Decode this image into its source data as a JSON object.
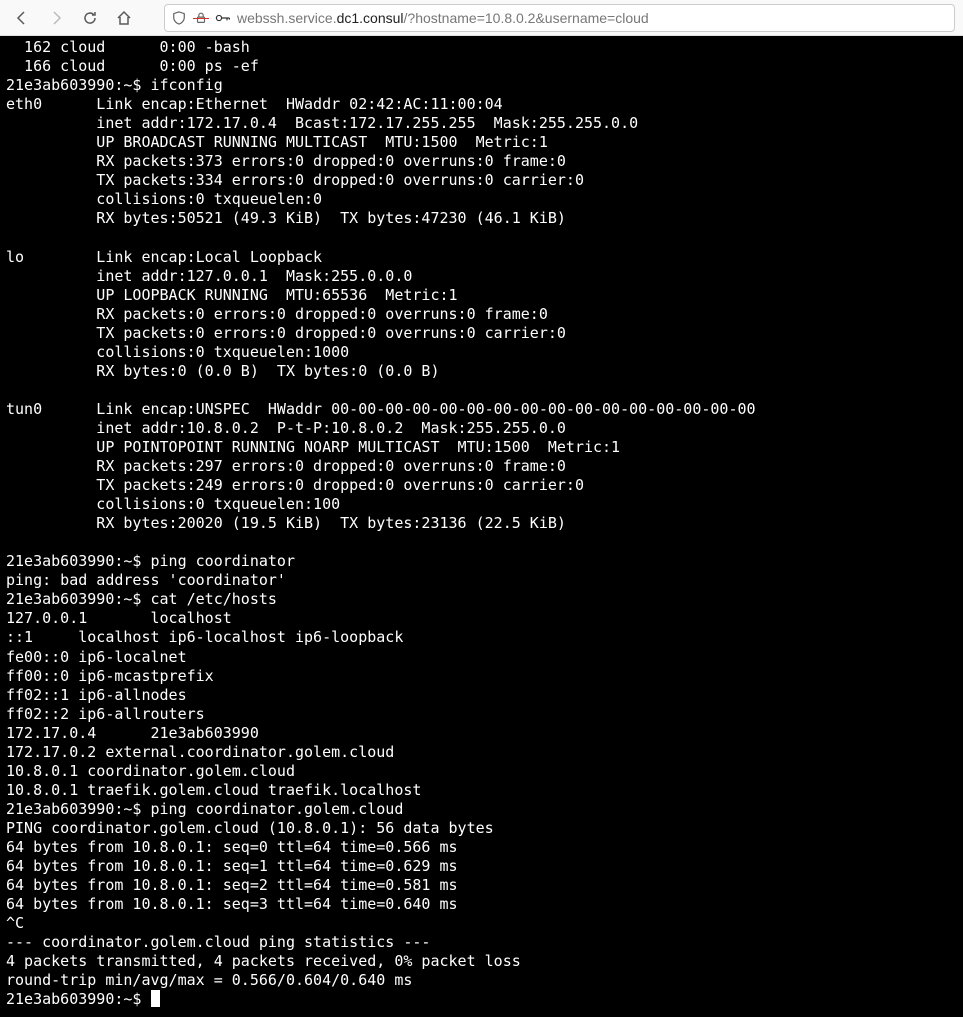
{
  "url": {
    "prefix": "webssh.service.",
    "bold": "dc1.consul",
    "suffix": "/?hostname=10.8.0.2&username=cloud"
  },
  "icons": {
    "back": "back-icon",
    "forward": "forward-icon",
    "reload": "reload-icon",
    "home": "home-icon",
    "shield": "shield-icon",
    "lock": "lock-strike-icon",
    "key": "key-icon"
  },
  "terminal_lines": [
    "  162 cloud      0:00 -bash",
    "  166 cloud      0:00 ps -ef",
    "21e3ab603990:~$ ifconfig",
    "eth0      Link encap:Ethernet  HWaddr 02:42:AC:11:00:04  ",
    "          inet addr:172.17.0.4  Bcast:172.17.255.255  Mask:255.255.0.0",
    "          UP BROADCAST RUNNING MULTICAST  MTU:1500  Metric:1",
    "          RX packets:373 errors:0 dropped:0 overruns:0 frame:0",
    "          TX packets:334 errors:0 dropped:0 overruns:0 carrier:0",
    "          collisions:0 txqueuelen:0 ",
    "          RX bytes:50521 (49.3 KiB)  TX bytes:47230 (46.1 KiB)",
    "",
    "lo        Link encap:Local Loopback  ",
    "          inet addr:127.0.0.1  Mask:255.0.0.0",
    "          UP LOOPBACK RUNNING  MTU:65536  Metric:1",
    "          RX packets:0 errors:0 dropped:0 overruns:0 frame:0",
    "          TX packets:0 errors:0 dropped:0 overruns:0 carrier:0",
    "          collisions:0 txqueuelen:1000 ",
    "          RX bytes:0 (0.0 B)  TX bytes:0 (0.0 B)",
    "",
    "tun0      Link encap:UNSPEC  HWaddr 00-00-00-00-00-00-00-00-00-00-00-00-00-00-00-00  ",
    "          inet addr:10.8.0.2  P-t-P:10.8.0.2  Mask:255.255.0.0",
    "          UP POINTOPOINT RUNNING NOARP MULTICAST  MTU:1500  Metric:1",
    "          RX packets:297 errors:0 dropped:0 overruns:0 frame:0",
    "          TX packets:249 errors:0 dropped:0 overruns:0 carrier:0",
    "          collisions:0 txqueuelen:100 ",
    "          RX bytes:20020 (19.5 KiB)  TX bytes:23136 (22.5 KiB)",
    "",
    "21e3ab603990:~$ ping coordinator",
    "ping: bad address 'coordinator'",
    "21e3ab603990:~$ cat /etc/hosts",
    "127.0.0.1       localhost",
    "::1     localhost ip6-localhost ip6-loopback",
    "fe00::0 ip6-localnet",
    "ff00::0 ip6-mcastprefix",
    "ff02::1 ip6-allnodes",
    "ff02::2 ip6-allrouters",
    "172.17.0.4      21e3ab603990",
    "172.17.0.2 external.coordinator.golem.cloud",
    "10.8.0.1 coordinator.golem.cloud",
    "10.8.0.1 traefik.golem.cloud traefik.localhost",
    "21e3ab603990:~$ ping coordinator.golem.cloud",
    "PING coordinator.golem.cloud (10.8.0.1): 56 data bytes",
    "64 bytes from 10.8.0.1: seq=0 ttl=64 time=0.566 ms",
    "64 bytes from 10.8.0.1: seq=1 ttl=64 time=0.629 ms",
    "64 bytes from 10.8.0.1: seq=2 ttl=64 time=0.581 ms",
    "64 bytes from 10.8.0.1: seq=3 ttl=64 time=0.640 ms",
    "^C",
    "--- coordinator.golem.cloud ping statistics ---",
    "4 packets transmitted, 4 packets received, 0% packet loss",
    "round-trip min/avg/max = 0.566/0.604/0.640 ms"
  ],
  "prompt_final": "21e3ab603990:~$ "
}
